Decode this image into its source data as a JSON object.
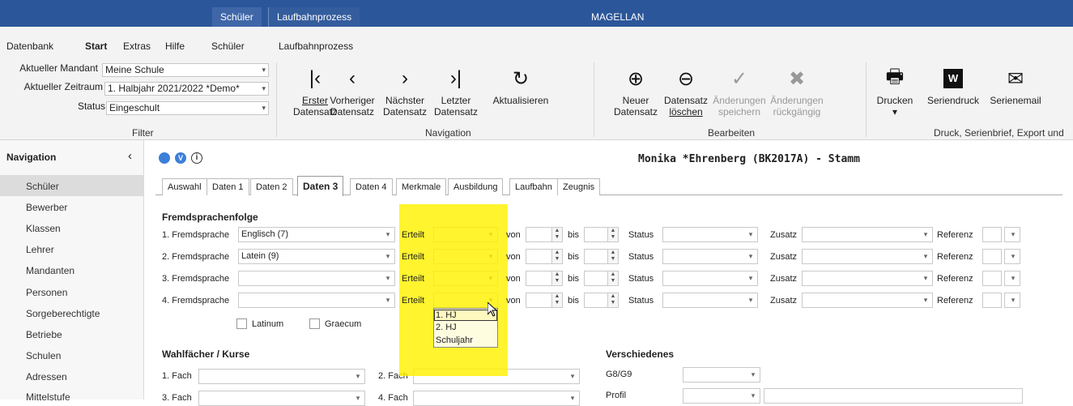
{
  "titlebar": {
    "context_tab_1": "Schüler",
    "context_tab_2": "Laufbahnprozess",
    "app_title": "MAGELLAN"
  },
  "ribbon_tabs": [
    "Datenbank",
    "Start",
    "Extras",
    "Hilfe",
    "Schüler",
    "Laufbahnprozess"
  ],
  "filter": {
    "mandant_label": "Aktueller Mandant",
    "mandant_value": "Meine Schule",
    "zeitraum_label": "Aktueller Zeitraum",
    "zeitraum_value": "1. Halbjahr 2021/2022 *Demo*",
    "status_label": "Status",
    "status_value": "Eingeschult",
    "group_label": "Filter"
  },
  "navigation_group": {
    "first_1": "Erster",
    "first_2": "Datensatz",
    "prev_1": "Vorheriger",
    "prev_2": "Datensatz",
    "next_1": "Nächster",
    "next_2": "Datensatz",
    "last_1": "Letzter",
    "last_2": "Datensatz",
    "refresh": "Aktualisieren",
    "group_label": "Navigation"
  },
  "edit_group": {
    "new_1": "Neuer",
    "new_2": "Datensatz",
    "delete_1": "Datensatz",
    "delete_2": "löschen",
    "save_1": "Änderungen",
    "save_2": "speichern",
    "undo_1": "Änderungen",
    "undo_2": "rückgängig",
    "group_label": "Bearbeiten"
  },
  "print_group": {
    "print": "Drucken",
    "serial_print": "Seriendruck",
    "serial_email": "Serienemail",
    "group_label": "Druck, Serienbrief, Export und"
  },
  "sidebar": {
    "title": "Navigation",
    "items": [
      "Schüler",
      "Bewerber",
      "Klassen",
      "Lehrer",
      "Mandanten",
      "Personen",
      "Sorgeberechtigte",
      "Betriebe",
      "Schulen",
      "Adressen",
      "Mittelstufe"
    ]
  },
  "record": {
    "title": "Monika *Ehrenberg (BK2017A) - Stamm"
  },
  "detail_tabs": [
    "Auswahl",
    "Daten 1",
    "Daten 2",
    "Daten 3",
    "Daten 4",
    "Merkmale",
    "Ausbildung",
    "Laufbahn",
    "Zeugnis"
  ],
  "languages": {
    "section": "Fremdsprachenfolge",
    "rows": [
      {
        "label": "1. Fremdsprache",
        "value": "Englisch (7)"
      },
      {
        "label": "2. Fremdsprache",
        "value": "Latein (9)"
      },
      {
        "label": "3. Fremdsprache",
        "value": ""
      },
      {
        "label": "4. Fremdsprache",
        "value": ""
      }
    ],
    "erteilt": "Erteilt",
    "von": "von",
    "bis": "bis",
    "status": "Status",
    "zusatz": "Zusatz",
    "referenz": "Referenz",
    "latinum": "Latinum",
    "graecum": "Graecum",
    "dropdown_options": [
      "1. HJ",
      "2. HJ",
      "Schuljahr"
    ]
  },
  "wahl": {
    "section": "Wahlfächer / Kurse",
    "fach1": "1. Fach",
    "fach2": "2. Fach",
    "fach3": "3. Fach",
    "fach4": "4. Fach"
  },
  "versch": {
    "section": "Verschiedenes",
    "g8g9": "G8/G9",
    "profil": "Profil"
  },
  "colors": {
    "titlebar": "#2b579a",
    "highlight": "#fff200",
    "accent": "#3d7fd8"
  }
}
